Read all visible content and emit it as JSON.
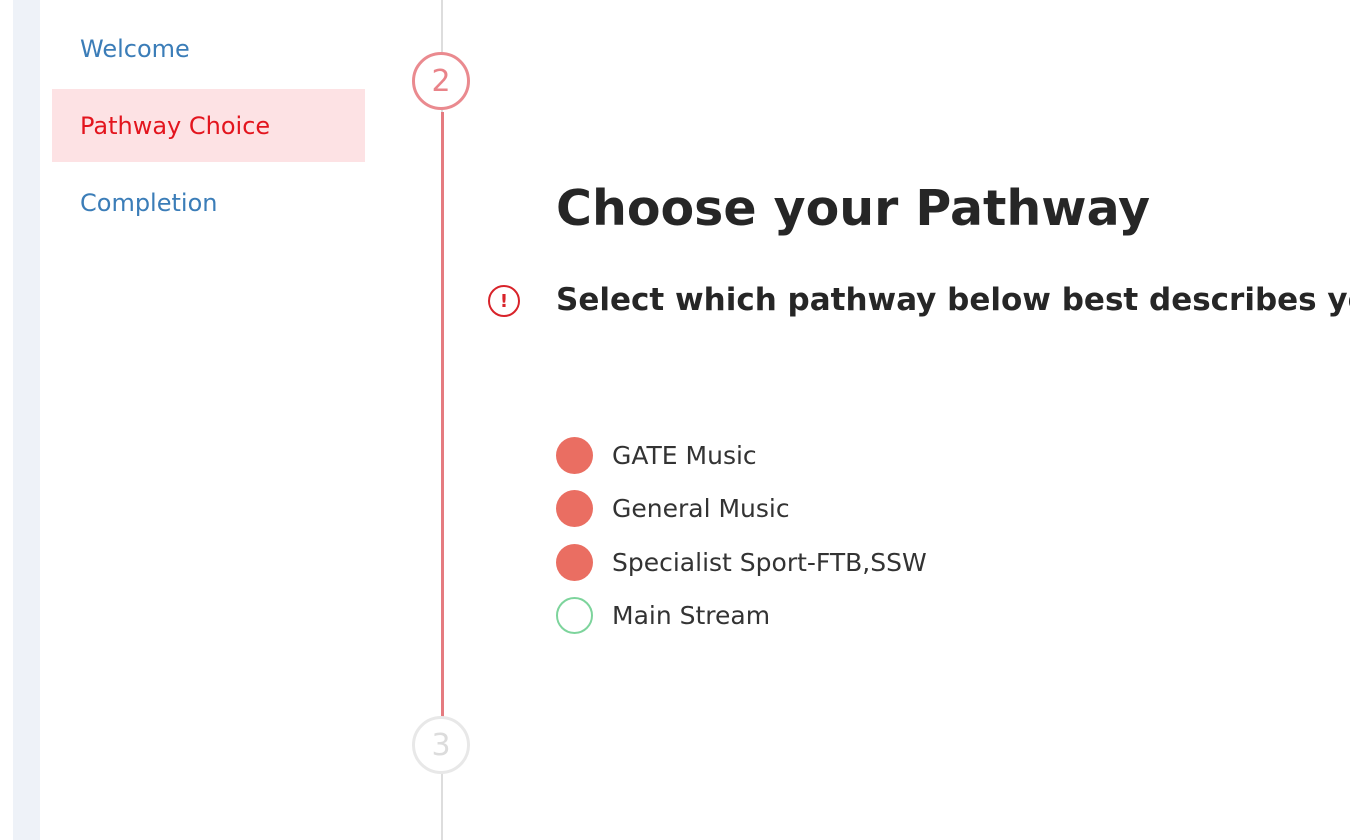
{
  "sidebar": {
    "items": [
      {
        "label": "Welcome"
      },
      {
        "label": "Pathway Choice"
      },
      {
        "label": "Completion"
      }
    ]
  },
  "steps": {
    "current": "2",
    "next": "3"
  },
  "main": {
    "title": "Choose your Pathway",
    "alert_icon": "exclamation-circle-icon",
    "alert_symbol": "!",
    "instruction": "Select which pathway below best describes you.",
    "options": [
      {
        "label": "GATE Music",
        "style": "filled"
      },
      {
        "label": "General Music",
        "style": "filled"
      },
      {
        "label": "Specialist Sport-FTB,SSW",
        "style": "filled"
      },
      {
        "label": "Main Stream",
        "style": "outline"
      }
    ]
  },
  "colors": {
    "accent_red": "#e3151e",
    "active_bg": "#fde2e4",
    "link_blue": "#3b7db8",
    "timeline": "#e57b80",
    "radio_filled": "#ea6e62",
    "radio_outline": "#7dd49c"
  }
}
